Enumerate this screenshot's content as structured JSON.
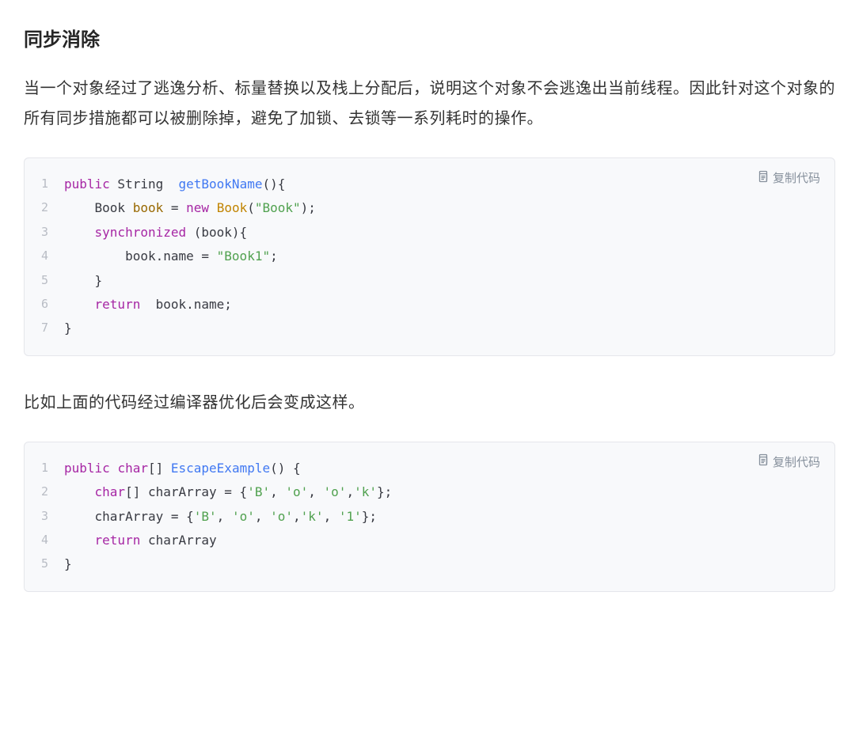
{
  "heading": "同步消除",
  "paragraph1": "当一个对象经过了逃逸分析、标量替换以及栈上分配后，说明这个对象不会逃逸出当前线程。因此针对这个对象的所有同步措施都可以被删除掉，避免了加锁、去锁等一系列耗时的操作。",
  "paragraph2": "比如上面的代码经过编译器优化后会变成这样。",
  "copy_label": "复制代码",
  "code1": {
    "lines": [
      {
        "no": "1",
        "tokens": [
          {
            "t": "public",
            "c": "tok-keyword"
          },
          {
            "t": " String  ",
            "c": ""
          },
          {
            "t": "getBookName",
            "c": "tok-func"
          },
          {
            "t": "(){",
            "c": ""
          }
        ]
      },
      {
        "no": "2",
        "tokens": [
          {
            "t": "    ",
            "c": ""
          },
          {
            "t": "Book",
            "c": "tok-type"
          },
          {
            "t": " ",
            "c": ""
          },
          {
            "t": "book",
            "c": "tok-var"
          },
          {
            "t": " = ",
            "c": ""
          },
          {
            "t": "new",
            "c": "tok-new"
          },
          {
            "t": " ",
            "c": ""
          },
          {
            "t": "Book",
            "c": "tok-class"
          },
          {
            "t": "(",
            "c": ""
          },
          {
            "t": "\"Book\"",
            "c": "tok-string"
          },
          {
            "t": ");",
            "c": ""
          }
        ]
      },
      {
        "no": "3",
        "tokens": [
          {
            "t": "    ",
            "c": ""
          },
          {
            "t": "synchronized",
            "c": "tok-keyword"
          },
          {
            "t": " (book){",
            "c": ""
          }
        ]
      },
      {
        "no": "4",
        "tokens": [
          {
            "t": "        book.name = ",
            "c": ""
          },
          {
            "t": "\"Book1\"",
            "c": "tok-string"
          },
          {
            "t": ";",
            "c": ""
          }
        ]
      },
      {
        "no": "5",
        "tokens": [
          {
            "t": "    }",
            "c": ""
          }
        ]
      },
      {
        "no": "6",
        "tokens": [
          {
            "t": "    ",
            "c": ""
          },
          {
            "t": "return",
            "c": "tok-keyword"
          },
          {
            "t": "  book.name;",
            "c": ""
          }
        ]
      },
      {
        "no": "7",
        "tokens": [
          {
            "t": "}",
            "c": ""
          }
        ]
      }
    ]
  },
  "code2": {
    "lines": [
      {
        "no": "1",
        "tokens": [
          {
            "t": "public",
            "c": "tok-keyword"
          },
          {
            "t": " ",
            "c": ""
          },
          {
            "t": "char",
            "c": "tok-keyword"
          },
          {
            "t": "[] ",
            "c": ""
          },
          {
            "t": "EscapeExample",
            "c": "tok-func"
          },
          {
            "t": "() {",
            "c": ""
          }
        ]
      },
      {
        "no": "2",
        "tokens": [
          {
            "t": "    ",
            "c": ""
          },
          {
            "t": "char",
            "c": "tok-keyword"
          },
          {
            "t": "[] charArray = {",
            "c": ""
          },
          {
            "t": "'B'",
            "c": "tok-char"
          },
          {
            "t": ", ",
            "c": ""
          },
          {
            "t": "'o'",
            "c": "tok-char"
          },
          {
            "t": ", ",
            "c": ""
          },
          {
            "t": "'o'",
            "c": "tok-char"
          },
          {
            "t": ",",
            "c": ""
          },
          {
            "t": "'k'",
            "c": "tok-char"
          },
          {
            "t": "};",
            "c": ""
          }
        ]
      },
      {
        "no": "3",
        "tokens": [
          {
            "t": "    charArray = {",
            "c": ""
          },
          {
            "t": "'B'",
            "c": "tok-char"
          },
          {
            "t": ", ",
            "c": ""
          },
          {
            "t": "'o'",
            "c": "tok-char"
          },
          {
            "t": ", ",
            "c": ""
          },
          {
            "t": "'o'",
            "c": "tok-char"
          },
          {
            "t": ",",
            "c": ""
          },
          {
            "t": "'k'",
            "c": "tok-char"
          },
          {
            "t": ", ",
            "c": ""
          },
          {
            "t": "'1'",
            "c": "tok-char"
          },
          {
            "t": "};",
            "c": ""
          }
        ]
      },
      {
        "no": "4",
        "tokens": [
          {
            "t": "    ",
            "c": ""
          },
          {
            "t": "return",
            "c": "tok-keyword"
          },
          {
            "t": " charArray",
            "c": ""
          }
        ]
      },
      {
        "no": "5",
        "tokens": [
          {
            "t": "}",
            "c": ""
          }
        ]
      }
    ]
  }
}
